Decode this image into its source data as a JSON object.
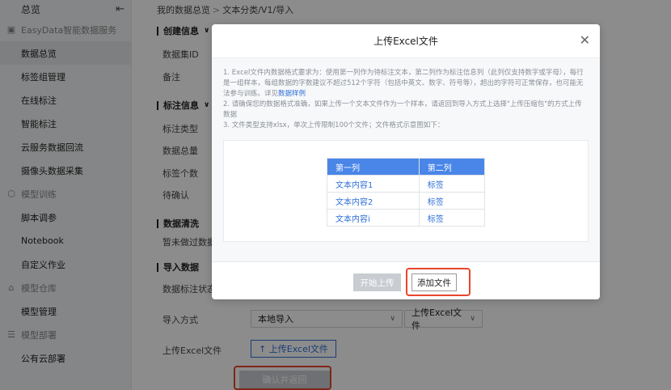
{
  "sidebar": {
    "top_title": "总览",
    "collapse_icon": "menu-collapse-icon",
    "sections": [
      {
        "type": "group",
        "label": "EasyData智能数据服务",
        "icon": "database-icon"
      },
      {
        "type": "item",
        "label": "数据总览",
        "active": true
      },
      {
        "type": "item",
        "label": "标签组管理"
      },
      {
        "type": "item",
        "label": "在线标注"
      },
      {
        "type": "item",
        "label": "智能标注"
      },
      {
        "type": "item",
        "label": "云服务数据回流"
      },
      {
        "type": "item",
        "label": "摄像头数据采集"
      },
      {
        "type": "group",
        "label": "模型训练",
        "icon": "cube-icon"
      },
      {
        "type": "item",
        "label": "脚本调参"
      },
      {
        "type": "item",
        "label": "Notebook"
      },
      {
        "type": "item",
        "label": "自定义作业"
      },
      {
        "type": "group",
        "label": "模型仓库",
        "icon": "warehouse-icon"
      },
      {
        "type": "item",
        "label": "模型管理"
      },
      {
        "type": "group",
        "label": "模型部署",
        "icon": "deploy-icon"
      },
      {
        "type": "item",
        "label": "公有云部署"
      }
    ]
  },
  "breadcrumb": {
    "parent": "我的数据总览",
    "separator": ">",
    "current": "文本分类/V1/导入"
  },
  "sections": {
    "create_info": "创建信息",
    "label_info": "标注信息",
    "data_clean": "数据清洗",
    "import_data": "导入数据"
  },
  "fields": {
    "dataset_id": "数据集ID",
    "remark": "备注",
    "label_type": "标注类型",
    "data_total": "数据总量",
    "label_count": "标签个数",
    "pending": "待确认",
    "clean_none": "暂未做过数据",
    "label_status": "数据标注状态",
    "import_method": "导入方式",
    "upload_excel": "上传Excel文件"
  },
  "import_form": {
    "method_value": "本地导入",
    "type_value": "上传Excel文件",
    "upload_button": "↑ 上传Excel文件",
    "confirm_button": "确认并返回"
  },
  "modal": {
    "title": "上传Excel文件",
    "close_icon": "close-icon",
    "desc_line1": "1. Excel文件内数据格式要求为：使用第一列作为待标注文本，第二列作为标注信息列（此列仅支持数字或字母），每行是一组样本，每组数据的字数建议不超过512个字符（包括中英文、数字、符号等），超出的字符可正常保存，也可能无法参与训练。详见",
    "desc_link": "数据样例",
    "desc_line2": "2. 请确保您的数据格式准确，如果上传一个文本文件作为一个样本，请返回到导入方式上选择\"上传压缩包\"的方式上传数据",
    "desc_line3": "3. 文件类型支持xlsx，单次上传限制100个文件；文件格式示意图如下：",
    "example_table": {
      "headers": [
        "第一列",
        "第二列"
      ],
      "rows": [
        [
          "文本内容1",
          "标签"
        ],
        [
          "文本内容2",
          "标签"
        ],
        [
          "文本内容i",
          "标签"
        ]
      ]
    },
    "start_button": "开始上传",
    "add_button": "添加文件"
  },
  "colors": {
    "accent": "#2e6fd6",
    "table_header": "#4a86e8",
    "highlight": "#e8452c",
    "disabled": "#c9ccd1"
  }
}
